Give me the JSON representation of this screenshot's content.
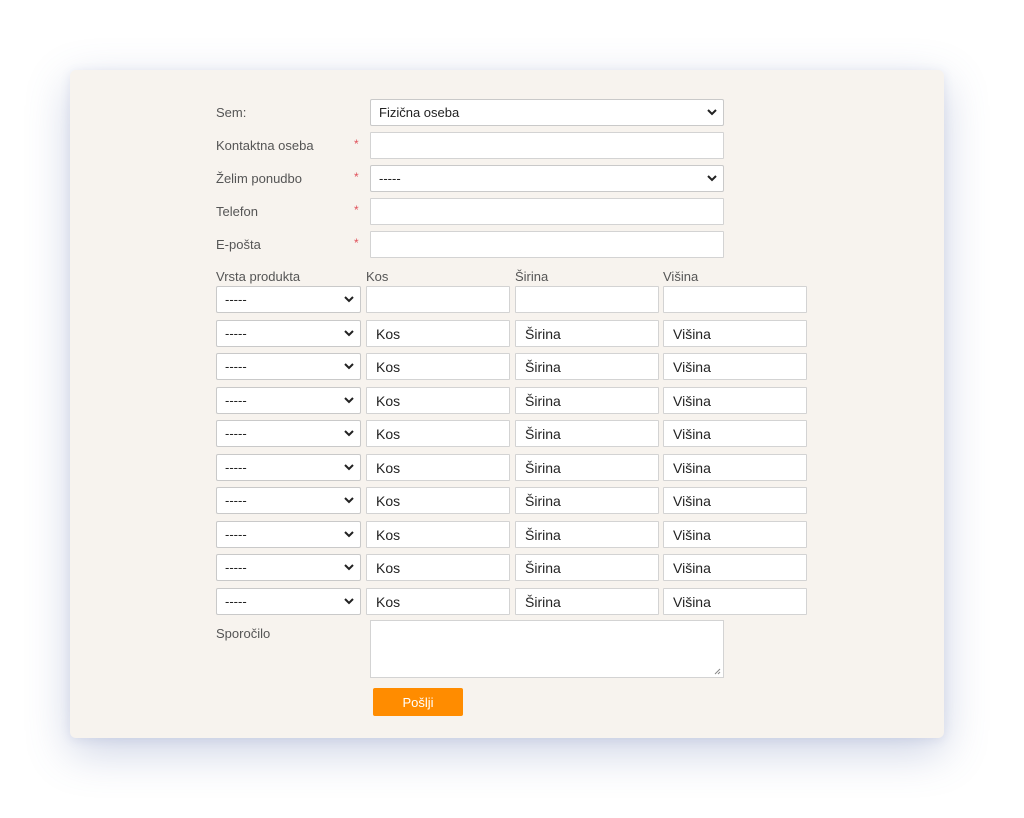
{
  "form": {
    "sem": {
      "label": "Sem:",
      "selected": "Fizična oseba"
    },
    "kontaktna_oseba": {
      "label": "Kontaktna oseba",
      "required_mark": "*",
      "value": ""
    },
    "zelim_ponudbo": {
      "label": "Želim ponudbo",
      "required_mark": "*",
      "selected": "-----"
    },
    "telefon": {
      "label": "Telefon",
      "required_mark": "*",
      "value": ""
    },
    "eposta": {
      "label": "E-pošta",
      "required_mark": "*",
      "value": ""
    },
    "products": {
      "headers": {
        "product_type": "Vrsta produkta",
        "kos": "Kos",
        "sirina": "Širina",
        "visina": "Višina"
      },
      "rows": [
        {
          "product_type": "-----",
          "kos": "",
          "sirina": "",
          "visina": ""
        },
        {
          "product_type": "-----",
          "kos": "Kos",
          "sirina": "Širina",
          "visina": "Višina"
        },
        {
          "product_type": "-----",
          "kos": "Kos",
          "sirina": "Širina",
          "visina": "Višina"
        },
        {
          "product_type": "-----",
          "kos": "Kos",
          "sirina": "Širina",
          "visina": "Višina"
        },
        {
          "product_type": "-----",
          "kos": "Kos",
          "sirina": "Širina",
          "visina": "Višina"
        },
        {
          "product_type": "-----",
          "kos": "Kos",
          "sirina": "Širina",
          "visina": "Višina"
        },
        {
          "product_type": "-----",
          "kos": "Kos",
          "sirina": "Širina",
          "visina": "Višina"
        },
        {
          "product_type": "-----",
          "kos": "Kos",
          "sirina": "Širina",
          "visina": "Višina"
        },
        {
          "product_type": "-----",
          "kos": "Kos",
          "sirina": "Širina",
          "visina": "Višina"
        },
        {
          "product_type": "-----",
          "kos": "Kos",
          "sirina": "Širina",
          "visina": "Višina"
        }
      ]
    },
    "sporocilo": {
      "label": "Sporočilo",
      "value": ""
    },
    "submit_label": "Pošlji"
  },
  "colors": {
    "card_background": "#f7f3ee",
    "accent": "#ff8c00",
    "required": "#e0505a"
  },
  "icons": {
    "dropdown": "chevron-down-icon",
    "resize": "resize-grip-icon"
  }
}
